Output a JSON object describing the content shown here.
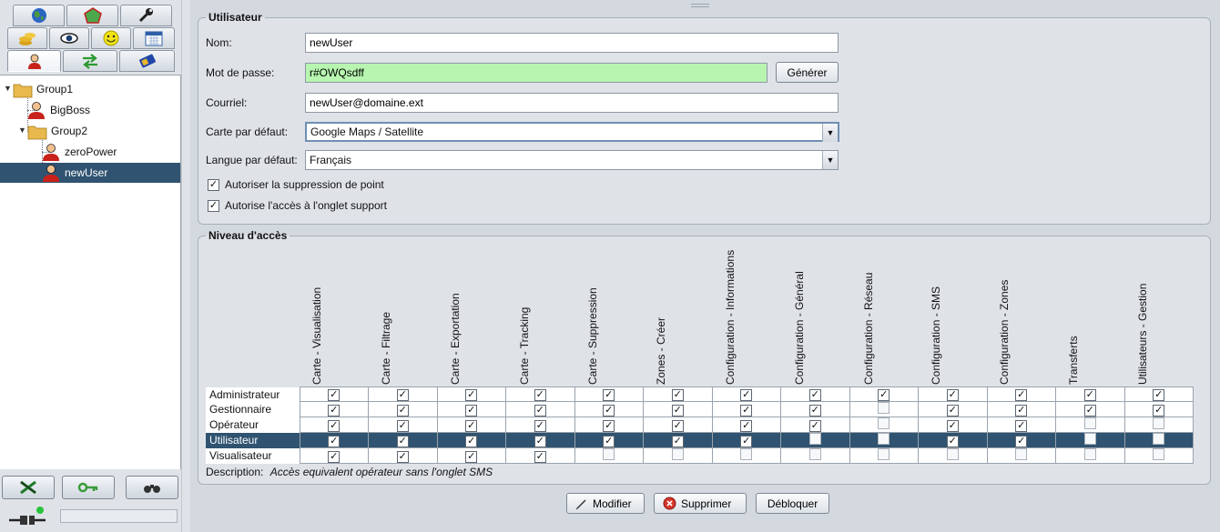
{
  "left": {
    "tool_tabs": [
      [
        "globe-icon",
        "pentagon-icon",
        "wrench-icon"
      ],
      [
        "coins-icon",
        "eye-icon",
        "smiley-icon",
        "calendar-icon"
      ],
      [
        "user-icon",
        "transfer-icon",
        "sim-card-icon"
      ]
    ],
    "tree": {
      "group1": "Group1",
      "bigboss": "BigBoss",
      "group2": "Group2",
      "zeropower": "zeroPower",
      "newuser": "newUser"
    }
  },
  "user": {
    "legend": "Utilisateur",
    "nom_label": "Nom:",
    "nom_value": "newUser",
    "pwd_label": "Mot de passe:",
    "pwd_value": "r#OWQsdff",
    "generate_label": "Générer",
    "email_label": "Courriel:",
    "email_value": "newUser@domaine.ext",
    "map_label": "Carte par défaut:",
    "map_value": "Google Maps / Satellite",
    "lang_label": "Langue par défaut:",
    "lang_value": "Français",
    "chk_delete_point": "Autoriser la suppression de point",
    "chk_support_tab": "Autorise l'accès à l'onglet support"
  },
  "access": {
    "legend": "Niveau d'accès",
    "columns": [
      "Carte - Visualisation",
      "Carte - Filtrage",
      "Carte - Exportation",
      "Carte - Tracking",
      "Carte - Suppression",
      "Zones - Créer",
      "Configuration - Informations",
      "Configuration - Général",
      "Configuration - Réseau",
      "Configuration - SMS",
      "Configuration - Zones",
      "Transferts",
      "Utilisateurs - Gestion"
    ],
    "rows": [
      {
        "label": "Administrateur",
        "checks": [
          1,
          1,
          1,
          1,
          1,
          1,
          1,
          1,
          1,
          1,
          1,
          1,
          1
        ]
      },
      {
        "label": "Gestionnaire",
        "checks": [
          1,
          1,
          1,
          1,
          1,
          1,
          1,
          1,
          0,
          1,
          1,
          1,
          1
        ]
      },
      {
        "label": "Opérateur",
        "checks": [
          1,
          1,
          1,
          1,
          1,
          1,
          1,
          1,
          0,
          1,
          1,
          0,
          0
        ]
      },
      {
        "label": "Utilisateur",
        "checks": [
          1,
          1,
          1,
          1,
          1,
          1,
          1,
          0,
          0,
          1,
          1,
          0,
          0
        ]
      },
      {
        "label": "Visualisateur",
        "checks": [
          1,
          1,
          1,
          1,
          0,
          0,
          0,
          0,
          0,
          0,
          0,
          0,
          0
        ]
      }
    ],
    "selected_row": 3,
    "description_label": "Description:",
    "description_value": "Accès equivalent opérateur sans l'onglet SMS"
  },
  "actions": {
    "modify": "Modifier",
    "delete": "Supprimer",
    "unlock": "Débloquer"
  },
  "colors": {
    "selection": "#2f5370",
    "password_bg": "#b7f5b0"
  }
}
